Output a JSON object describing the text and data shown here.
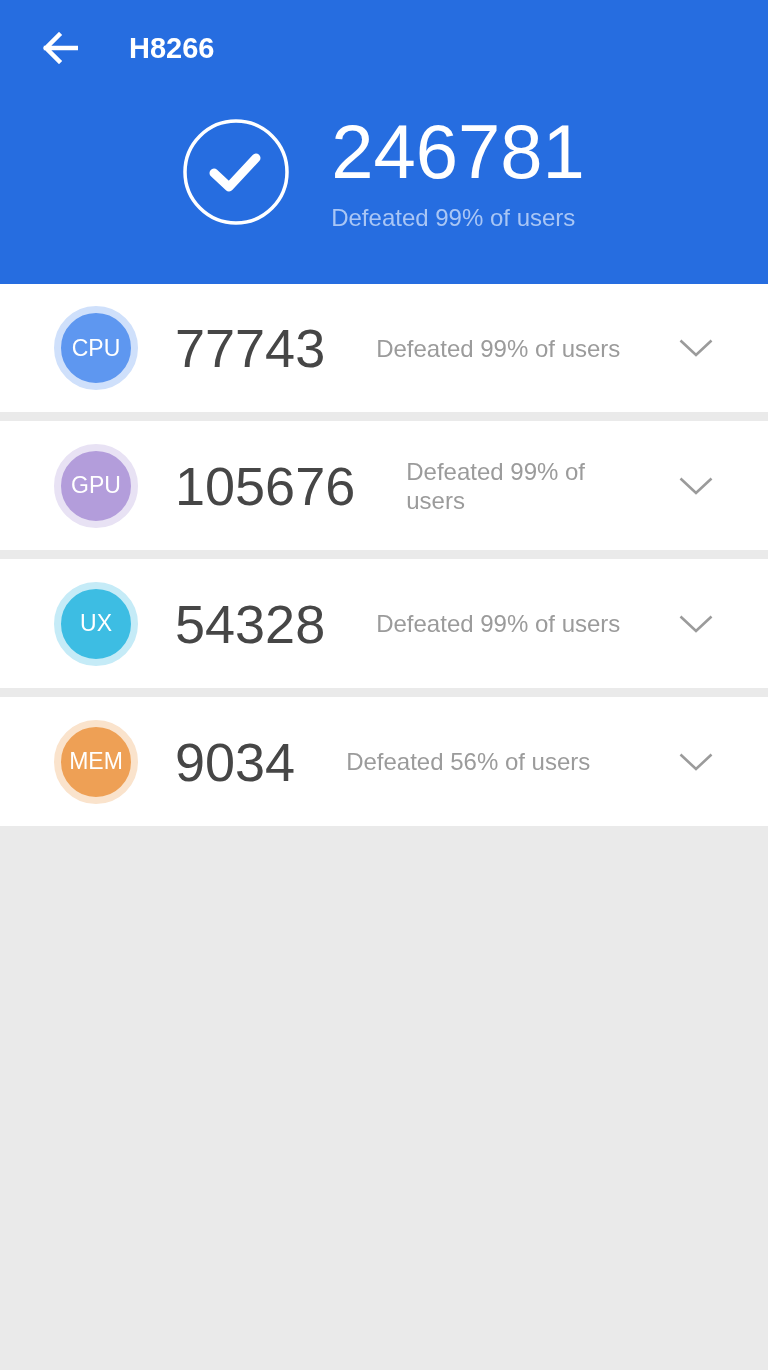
{
  "header": {
    "title": "H8266",
    "score": "246781",
    "caption": "Defeated 99% of users"
  },
  "results": [
    {
      "label": "CPU",
      "color": "#5e97f0",
      "score": "77743",
      "caption": "Defeated 99% of users",
      "expanded": false
    },
    {
      "label": "GPU",
      "color": "#b39ddb",
      "score": "105676",
      "caption": "Defeated 99% of users",
      "expanded": false
    },
    {
      "label": "UX",
      "color": "#3dbde3",
      "score": "54328",
      "caption": "Defeated 99% of users",
      "expanded": false
    },
    {
      "label": "MEM",
      "color": "#eea055",
      "score": "9034",
      "caption": "Defeated 56% of users",
      "expanded": false
    }
  ]
}
